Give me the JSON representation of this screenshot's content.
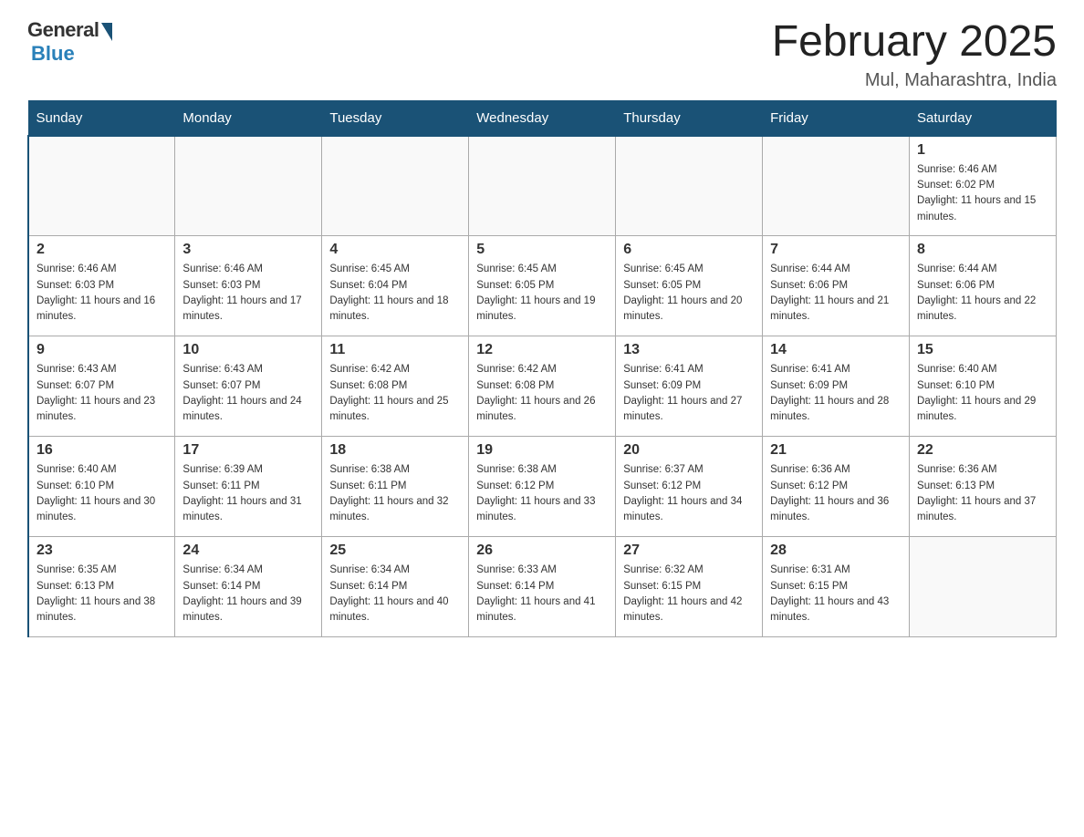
{
  "logo": {
    "general_text": "General",
    "blue_text": "Blue",
    "subtitle": "Blue"
  },
  "header": {
    "title": "February 2025",
    "location": "Mul, Maharashtra, India"
  },
  "weekdays": [
    "Sunday",
    "Monday",
    "Tuesday",
    "Wednesday",
    "Thursday",
    "Friday",
    "Saturday"
  ],
  "weeks": [
    [
      {
        "day": "",
        "sunrise": "",
        "sunset": "",
        "daylight": ""
      },
      {
        "day": "",
        "sunrise": "",
        "sunset": "",
        "daylight": ""
      },
      {
        "day": "",
        "sunrise": "",
        "sunset": "",
        "daylight": ""
      },
      {
        "day": "",
        "sunrise": "",
        "sunset": "",
        "daylight": ""
      },
      {
        "day": "",
        "sunrise": "",
        "sunset": "",
        "daylight": ""
      },
      {
        "day": "",
        "sunrise": "",
        "sunset": "",
        "daylight": ""
      },
      {
        "day": "1",
        "sunrise": "Sunrise: 6:46 AM",
        "sunset": "Sunset: 6:02 PM",
        "daylight": "Daylight: 11 hours and 15 minutes."
      }
    ],
    [
      {
        "day": "2",
        "sunrise": "Sunrise: 6:46 AM",
        "sunset": "Sunset: 6:03 PM",
        "daylight": "Daylight: 11 hours and 16 minutes."
      },
      {
        "day": "3",
        "sunrise": "Sunrise: 6:46 AM",
        "sunset": "Sunset: 6:03 PM",
        "daylight": "Daylight: 11 hours and 17 minutes."
      },
      {
        "day": "4",
        "sunrise": "Sunrise: 6:45 AM",
        "sunset": "Sunset: 6:04 PM",
        "daylight": "Daylight: 11 hours and 18 minutes."
      },
      {
        "day": "5",
        "sunrise": "Sunrise: 6:45 AM",
        "sunset": "Sunset: 6:05 PM",
        "daylight": "Daylight: 11 hours and 19 minutes."
      },
      {
        "day": "6",
        "sunrise": "Sunrise: 6:45 AM",
        "sunset": "Sunset: 6:05 PM",
        "daylight": "Daylight: 11 hours and 20 minutes."
      },
      {
        "day": "7",
        "sunrise": "Sunrise: 6:44 AM",
        "sunset": "Sunset: 6:06 PM",
        "daylight": "Daylight: 11 hours and 21 minutes."
      },
      {
        "day": "8",
        "sunrise": "Sunrise: 6:44 AM",
        "sunset": "Sunset: 6:06 PM",
        "daylight": "Daylight: 11 hours and 22 minutes."
      }
    ],
    [
      {
        "day": "9",
        "sunrise": "Sunrise: 6:43 AM",
        "sunset": "Sunset: 6:07 PM",
        "daylight": "Daylight: 11 hours and 23 minutes."
      },
      {
        "day": "10",
        "sunrise": "Sunrise: 6:43 AM",
        "sunset": "Sunset: 6:07 PM",
        "daylight": "Daylight: 11 hours and 24 minutes."
      },
      {
        "day": "11",
        "sunrise": "Sunrise: 6:42 AM",
        "sunset": "Sunset: 6:08 PM",
        "daylight": "Daylight: 11 hours and 25 minutes."
      },
      {
        "day": "12",
        "sunrise": "Sunrise: 6:42 AM",
        "sunset": "Sunset: 6:08 PM",
        "daylight": "Daylight: 11 hours and 26 minutes."
      },
      {
        "day": "13",
        "sunrise": "Sunrise: 6:41 AM",
        "sunset": "Sunset: 6:09 PM",
        "daylight": "Daylight: 11 hours and 27 minutes."
      },
      {
        "day": "14",
        "sunrise": "Sunrise: 6:41 AM",
        "sunset": "Sunset: 6:09 PM",
        "daylight": "Daylight: 11 hours and 28 minutes."
      },
      {
        "day": "15",
        "sunrise": "Sunrise: 6:40 AM",
        "sunset": "Sunset: 6:10 PM",
        "daylight": "Daylight: 11 hours and 29 minutes."
      }
    ],
    [
      {
        "day": "16",
        "sunrise": "Sunrise: 6:40 AM",
        "sunset": "Sunset: 6:10 PM",
        "daylight": "Daylight: 11 hours and 30 minutes."
      },
      {
        "day": "17",
        "sunrise": "Sunrise: 6:39 AM",
        "sunset": "Sunset: 6:11 PM",
        "daylight": "Daylight: 11 hours and 31 minutes."
      },
      {
        "day": "18",
        "sunrise": "Sunrise: 6:38 AM",
        "sunset": "Sunset: 6:11 PM",
        "daylight": "Daylight: 11 hours and 32 minutes."
      },
      {
        "day": "19",
        "sunrise": "Sunrise: 6:38 AM",
        "sunset": "Sunset: 6:12 PM",
        "daylight": "Daylight: 11 hours and 33 minutes."
      },
      {
        "day": "20",
        "sunrise": "Sunrise: 6:37 AM",
        "sunset": "Sunset: 6:12 PM",
        "daylight": "Daylight: 11 hours and 34 minutes."
      },
      {
        "day": "21",
        "sunrise": "Sunrise: 6:36 AM",
        "sunset": "Sunset: 6:12 PM",
        "daylight": "Daylight: 11 hours and 36 minutes."
      },
      {
        "day": "22",
        "sunrise": "Sunrise: 6:36 AM",
        "sunset": "Sunset: 6:13 PM",
        "daylight": "Daylight: 11 hours and 37 minutes."
      }
    ],
    [
      {
        "day": "23",
        "sunrise": "Sunrise: 6:35 AM",
        "sunset": "Sunset: 6:13 PM",
        "daylight": "Daylight: 11 hours and 38 minutes."
      },
      {
        "day": "24",
        "sunrise": "Sunrise: 6:34 AM",
        "sunset": "Sunset: 6:14 PM",
        "daylight": "Daylight: 11 hours and 39 minutes."
      },
      {
        "day": "25",
        "sunrise": "Sunrise: 6:34 AM",
        "sunset": "Sunset: 6:14 PM",
        "daylight": "Daylight: 11 hours and 40 minutes."
      },
      {
        "day": "26",
        "sunrise": "Sunrise: 6:33 AM",
        "sunset": "Sunset: 6:14 PM",
        "daylight": "Daylight: 11 hours and 41 minutes."
      },
      {
        "day": "27",
        "sunrise": "Sunrise: 6:32 AM",
        "sunset": "Sunset: 6:15 PM",
        "daylight": "Daylight: 11 hours and 42 minutes."
      },
      {
        "day": "28",
        "sunrise": "Sunrise: 6:31 AM",
        "sunset": "Sunset: 6:15 PM",
        "daylight": "Daylight: 11 hours and 43 minutes."
      },
      {
        "day": "",
        "sunrise": "",
        "sunset": "",
        "daylight": ""
      }
    ]
  ]
}
